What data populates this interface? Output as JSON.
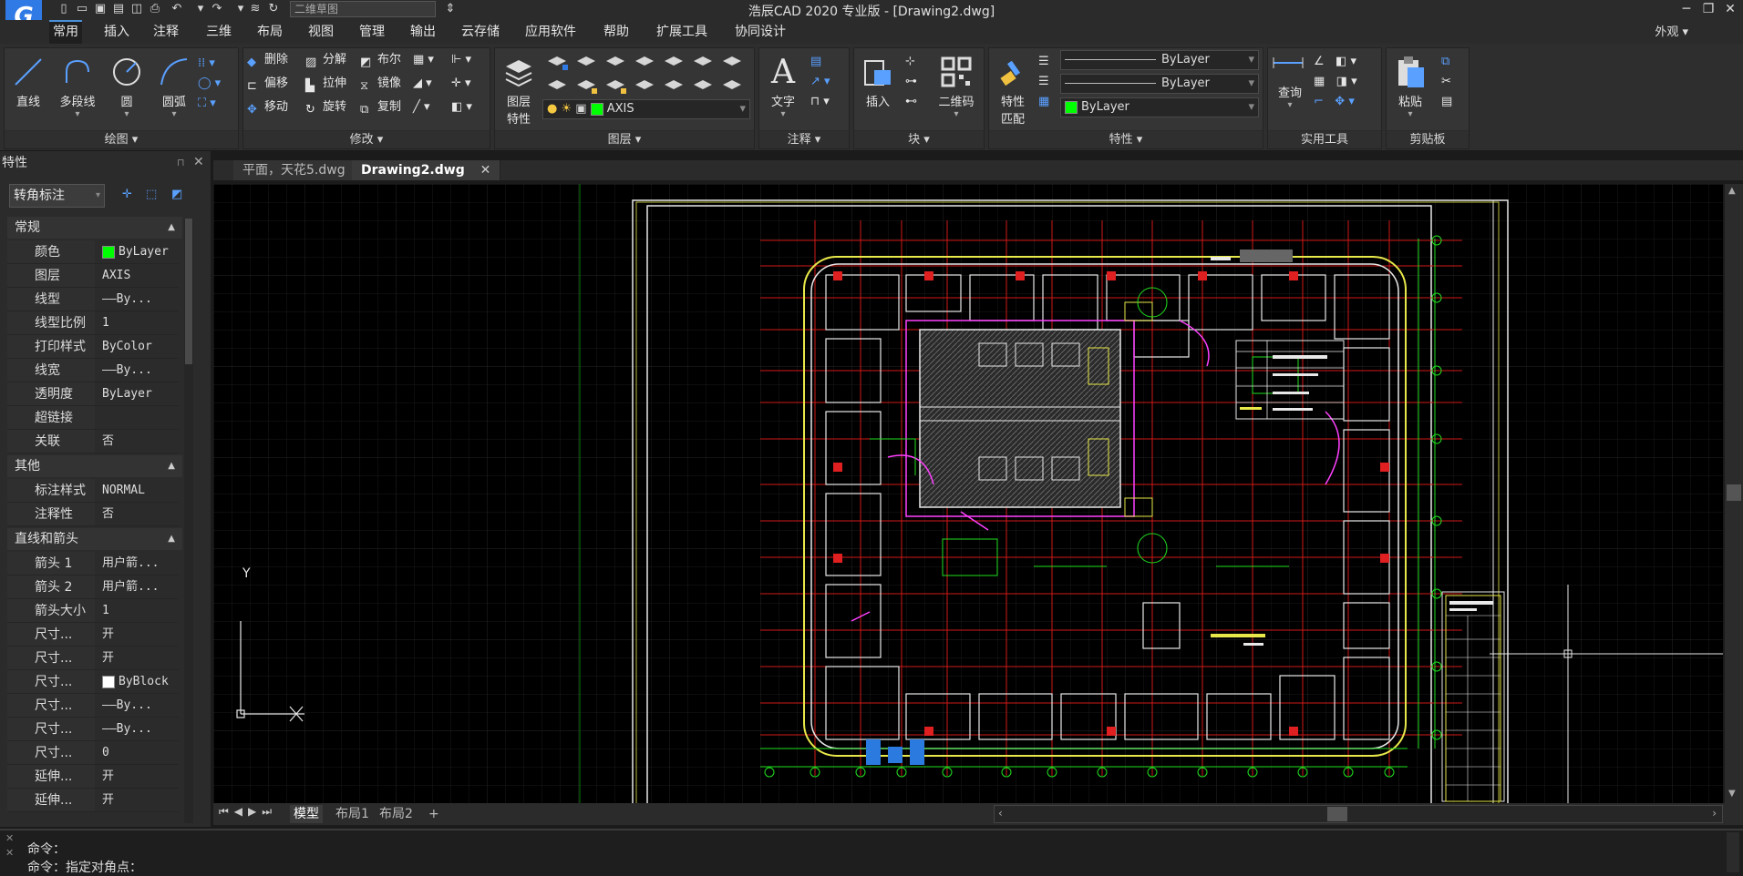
{
  "app": {
    "title": "浩辰CAD 2020 专业版 - [Drawing2.dwg]",
    "logo_letter": "G",
    "workspace": "二维草图",
    "appearance": "外观"
  },
  "menu": [
    "常用",
    "插入",
    "注释",
    "三维",
    "布局",
    "视图",
    "管理",
    "输出",
    "云存储",
    "应用软件",
    "帮助",
    "扩展工具",
    "协同设计"
  ],
  "ribbon": {
    "draw": {
      "title": "绘图",
      "line": "直线",
      "polyline": "多段线",
      "circle": "圆",
      "arc": "圆弧"
    },
    "modify": {
      "title": "修改",
      "erase": "删除",
      "explode": "分解",
      "boolean": "布尔",
      "offset": "偏移",
      "stretch": "拉伸",
      "mirror": "镜像",
      "move": "移动",
      "rotate": "旋转",
      "copy": "复制"
    },
    "layer": {
      "title": "图层",
      "props": "图层\n特性",
      "props_l1": "图层",
      "props_l2": "特性",
      "current": "AXIS",
      "color": "#00ff00"
    },
    "annotation": {
      "title": "注释",
      "text": "文字"
    },
    "block": {
      "title": "块",
      "insert": "插入",
      "qrcode": "二维码"
    },
    "properties": {
      "title": "特性",
      "match_l1": "特性",
      "match_l2": "匹配",
      "linetype": "ByLayer",
      "lineweight": "ByLayer",
      "color": "ByLayer"
    },
    "utilities": {
      "title": "实用工具",
      "query": "查询"
    },
    "clipboard": {
      "title": "剪贴板",
      "paste": "粘贴"
    }
  },
  "props_panel": {
    "title": "特性",
    "selection": "转角标注",
    "sections": {
      "general": {
        "title": "常规",
        "rows": [
          {
            "k": "颜色",
            "v": "ByLayer"
          },
          {
            "k": "图层",
            "v": "AXIS"
          },
          {
            "k": "线型",
            "v": "——By..."
          },
          {
            "k": "线型比例",
            "v": "1"
          },
          {
            "k": "打印样式",
            "v": "ByColor"
          },
          {
            "k": "线宽",
            "v": "——By..."
          },
          {
            "k": "透明度",
            "v": "ByLayer"
          },
          {
            "k": "超链接",
            "v": ""
          },
          {
            "k": "关联",
            "v": "否"
          }
        ]
      },
      "misc": {
        "title": "其他",
        "rows": [
          {
            "k": "标注样式",
            "v": "NORMAL"
          },
          {
            "k": "注释性",
            "v": "否"
          }
        ]
      },
      "lines": {
        "title": "直线和箭头",
        "rows": [
          {
            "k": "箭头 1",
            "v": "用户箭..."
          },
          {
            "k": "箭头 2",
            "v": "用户箭..."
          },
          {
            "k": "箭头大小",
            "v": "1"
          },
          {
            "k": "尺寸...",
            "v": "开"
          },
          {
            "k": "尺寸...",
            "v": "开"
          },
          {
            "k": "尺寸...",
            "v": "ByBlock"
          },
          {
            "k": "尺寸...",
            "v": "——By..."
          },
          {
            "k": "尺寸...",
            "v": "——By..."
          },
          {
            "k": "尺寸...",
            "v": "0"
          },
          {
            "k": "延伸...",
            "v": "开"
          },
          {
            "k": "延伸...",
            "v": "开"
          }
        ]
      }
    }
  },
  "doc_tabs": [
    "平面，天花5.dwg",
    "Drawing2.dwg"
  ],
  "layout_tabs": [
    "模型",
    "布局1",
    "布局2",
    "+"
  ],
  "command_lines": [
    "命令：",
    "命令：指定对角点："
  ],
  "ucs": {
    "y_label": "Y"
  }
}
